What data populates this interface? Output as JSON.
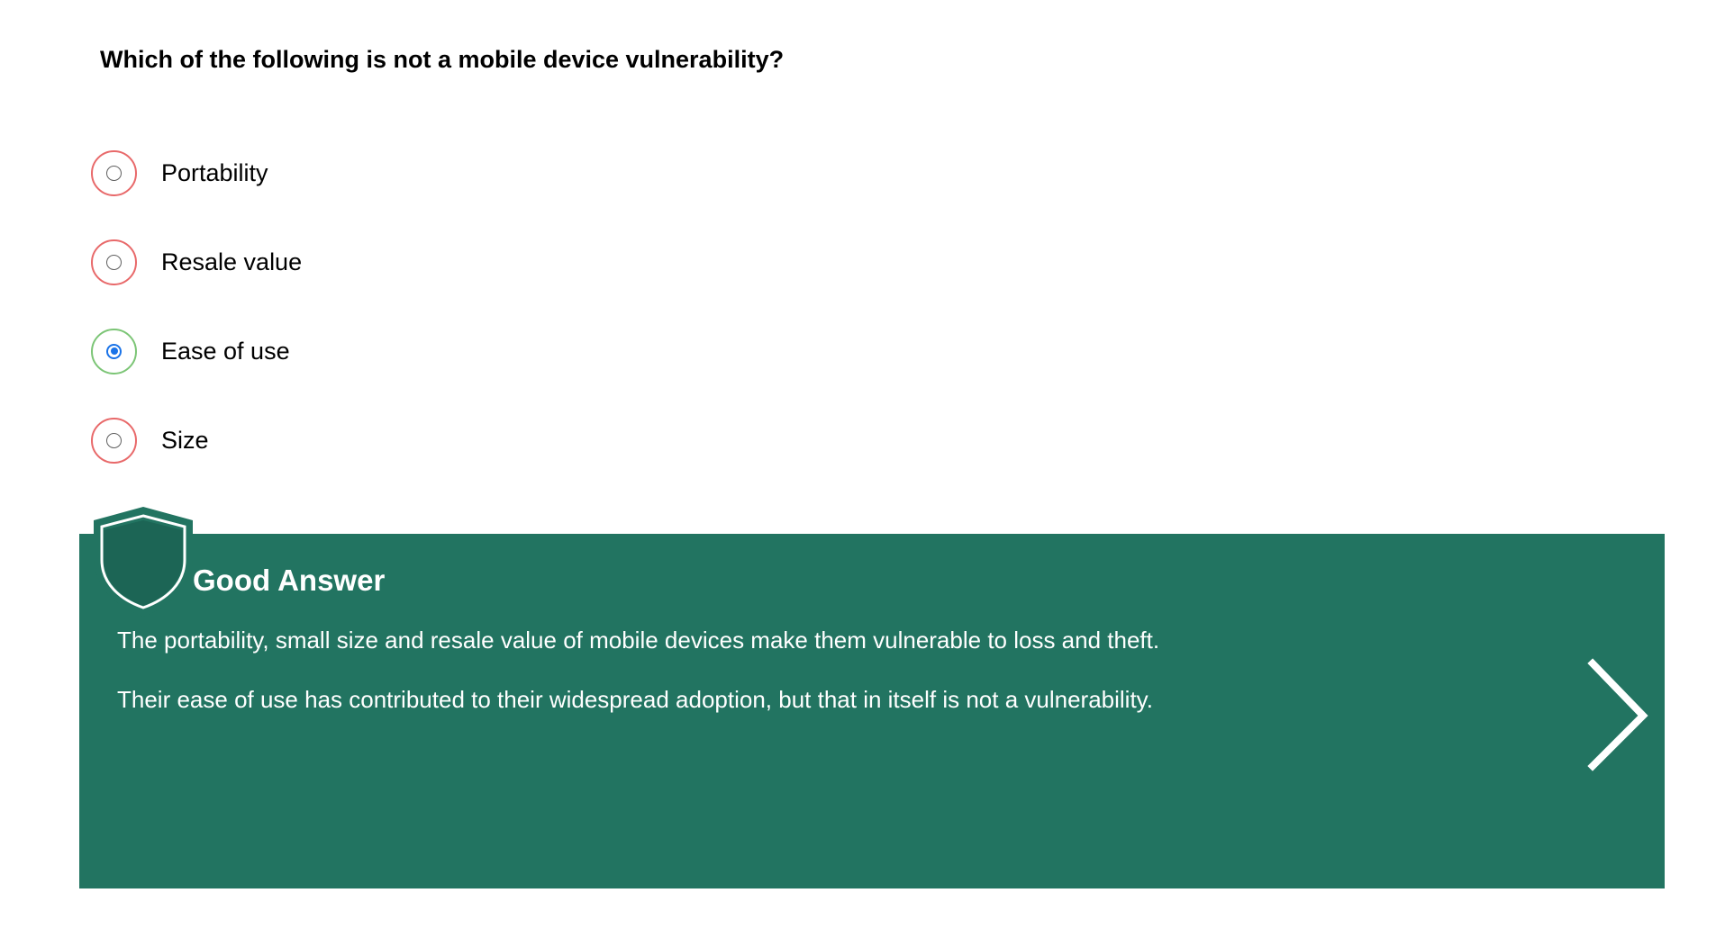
{
  "question": {
    "text": "Which of the following is not a mobile device vulnerability?"
  },
  "options": [
    {
      "label": "Portability",
      "selected": false,
      "status": "incorrect"
    },
    {
      "label": "Resale value",
      "selected": false,
      "status": "incorrect"
    },
    {
      "label": "Ease of use",
      "selected": true,
      "status": "correct"
    },
    {
      "label": "Size",
      "selected": false,
      "status": "incorrect"
    }
  ],
  "feedback": {
    "title": "Good Answer",
    "paragraphs": [
      "The portability, small size and resale value of mobile devices make them vulnerable to loss and theft.",
      "Their ease of use has contributed to their widespread adoption, but that in itself is not a vulnerability."
    ],
    "icon": "shield-icon",
    "next_icon": "chevron-right-icon"
  },
  "colors": {
    "feedback_background": "#227461",
    "incorrect_ring": "#e8696a",
    "correct_ring": "#7cc576",
    "radio_selected": "#1a73e8"
  }
}
